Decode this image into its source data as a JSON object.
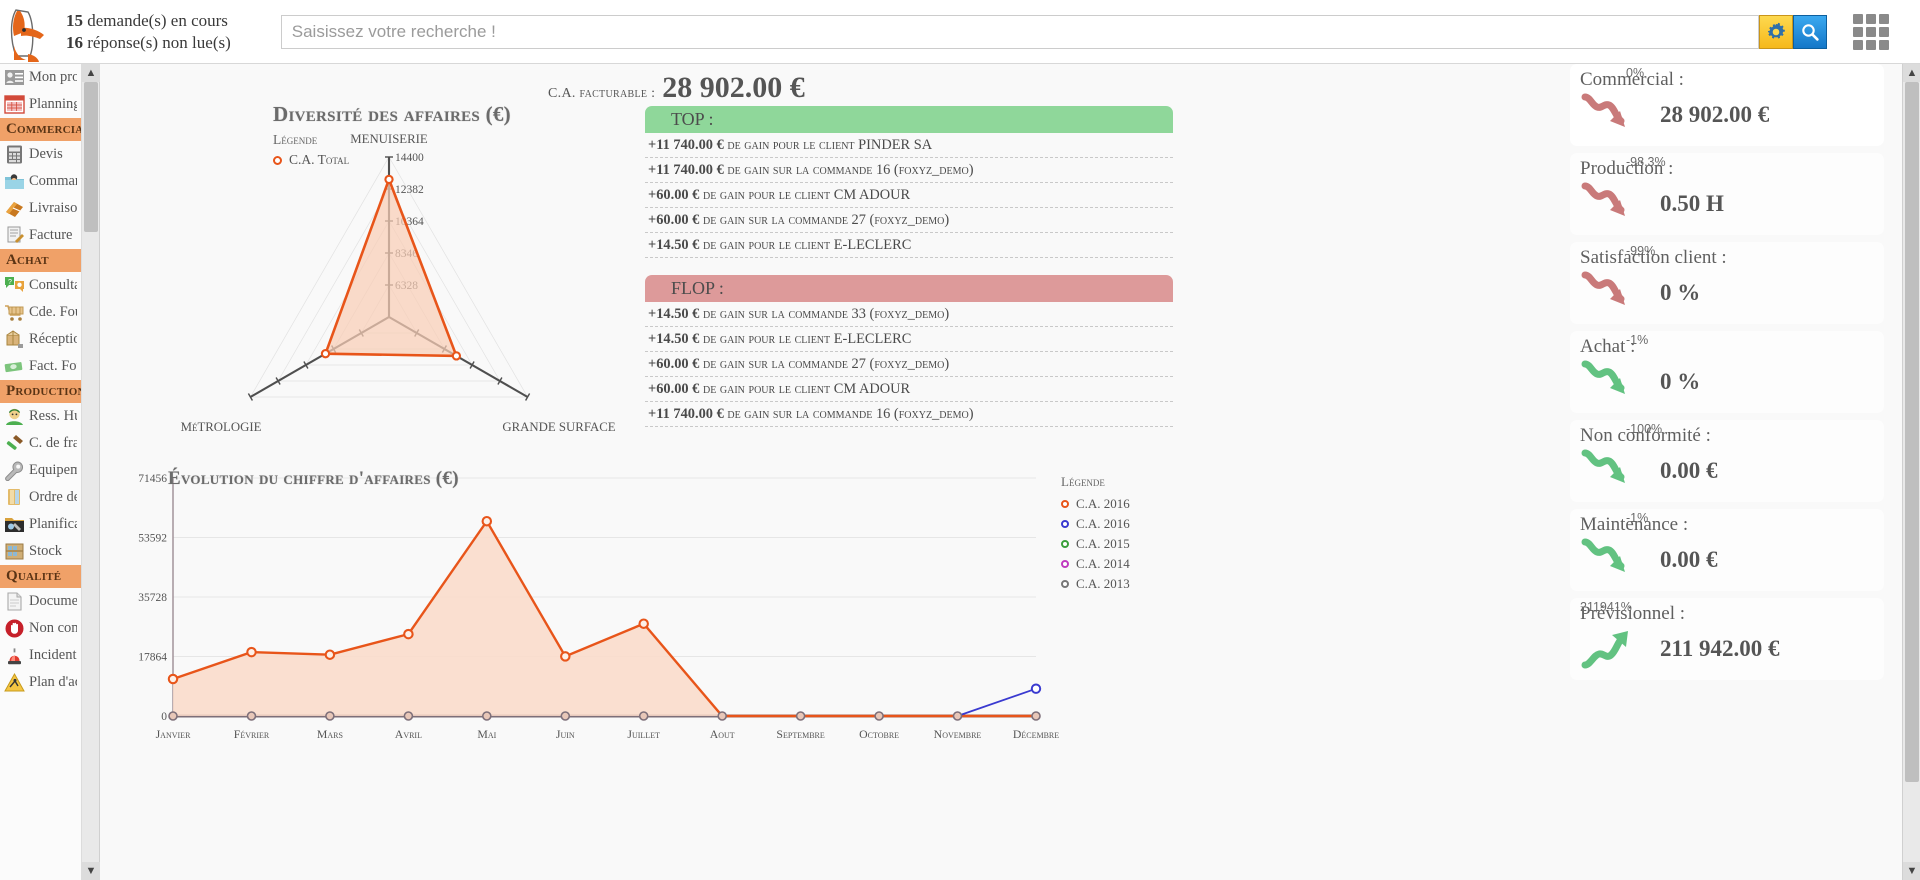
{
  "header": {
    "demandes": "15",
    "demandes_text": "demande(s) en cours",
    "reponses": "16",
    "reponses_text": "réponse(s) non lue(s)",
    "search_placeholder": "Saisissez votre recherche !",
    "search_value": "",
    "gear_icon": "gear-icon",
    "search_icon": "search-icon",
    "apps_icon": "apps-grid-icon",
    "home_icon": "home-icon"
  },
  "sidebar": {
    "items": [
      {
        "type": "item",
        "label": "Mon profil",
        "icon": "profile-icon"
      },
      {
        "type": "item",
        "label": "Planning",
        "icon": "calendar-icon"
      },
      {
        "type": "head",
        "label": "Commercial"
      },
      {
        "type": "item",
        "label": "Devis",
        "icon": "calculator-icon"
      },
      {
        "type": "item",
        "label": "Commande",
        "icon": "order-folder-icon"
      },
      {
        "type": "item",
        "label": "Livraison",
        "icon": "delivery-icon"
      },
      {
        "type": "item",
        "label": "Facture",
        "icon": "invoice-icon"
      },
      {
        "type": "head",
        "label": "Achat"
      },
      {
        "type": "item",
        "label": "Consultation",
        "icon": "consultation-icon"
      },
      {
        "type": "item",
        "label": "Cde. Fourn.",
        "icon": "cart-icon"
      },
      {
        "type": "item",
        "label": "Réception",
        "icon": "package-icon"
      },
      {
        "type": "item",
        "label": "Fact. Fourn.",
        "icon": "money-icon"
      },
      {
        "type": "head",
        "label": "Production"
      },
      {
        "type": "item",
        "label": "Ress. Hum.",
        "icon": "worker-icon"
      },
      {
        "type": "item",
        "label": "C. de frais",
        "icon": "hammer-icon"
      },
      {
        "type": "item",
        "label": "Equipement",
        "icon": "wrench-icon"
      },
      {
        "type": "item",
        "label": "Ordre de fab.",
        "icon": "book-folder-icon"
      },
      {
        "type": "item",
        "label": "Planification",
        "icon": "planning-folder-icon"
      },
      {
        "type": "item",
        "label": "Stock",
        "icon": "shelf-icon"
      },
      {
        "type": "head",
        "label": "Qualité"
      },
      {
        "type": "item",
        "label": "Document",
        "icon": "document-icon"
      },
      {
        "type": "item",
        "label": "Non confor.",
        "icon": "stop-hand-icon"
      },
      {
        "type": "item",
        "label": "Incident",
        "icon": "siren-icon"
      },
      {
        "type": "item",
        "label": "Plan d'actions",
        "icon": "warning-triangle-icon"
      }
    ]
  },
  "main": {
    "ca_label": "C.A. facturable :",
    "ca_value": "28 902.00 €"
  },
  "top_list": {
    "title": "TOP :",
    "color": "#8fd79a",
    "rows": [
      {
        "amount": "+11 740.00 €",
        "mid": "de gain pour le client",
        "tail": "PINDER SA"
      },
      {
        "amount": "+11 740.00 €",
        "mid": "de gain sur la commande",
        "tail": "16 (foxyz_demo)"
      },
      {
        "amount": "+60.00 €",
        "mid": "de gain pour le client",
        "tail": "CM ADOUR"
      },
      {
        "amount": "+60.00 €",
        "mid": "de gain sur la commande",
        "tail": "27 (foxyz_demo)"
      },
      {
        "amount": "+14.50 €",
        "mid": "de gain pour le client",
        "tail": "E-LECLERC"
      }
    ]
  },
  "flop_list": {
    "title": "FLOP :",
    "color": "#dd9a9a",
    "rows": [
      {
        "amount": "+14.50 €",
        "mid": "de gain sur la commande",
        "tail": "33 (foxyz_demo)"
      },
      {
        "amount": "+14.50 €",
        "mid": "de gain pour le client",
        "tail": "E-LECLERC"
      },
      {
        "amount": "+60.00 €",
        "mid": "de gain sur la commande",
        "tail": "27 (foxyz_demo)"
      },
      {
        "amount": "+60.00 €",
        "mid": "de gain pour le client",
        "tail": "CM ADOUR"
      },
      {
        "amount": "+11 740.00 €",
        "mid": "de gain sur la commande",
        "tail": "16 (foxyz_demo)"
      }
    ]
  },
  "kpi": {
    "cards": [
      {
        "title": "Commercial :",
        "pct": "0%",
        "value": "28 902.00 €",
        "dir": "down",
        "color": "#c97a7a"
      },
      {
        "title": "Production :",
        "pct": "-98.3%",
        "value": "0.50 H",
        "dir": "down",
        "color": "#c97a7a"
      },
      {
        "title": "Satisfaction client :",
        "pct": "-99%",
        "value": "0 %",
        "dir": "down",
        "color": "#c97a7a"
      },
      {
        "title": "Achat :",
        "pct": "-1%",
        "value": "0 %",
        "dir": "down",
        "color": "#62c281"
      },
      {
        "title": "Non conformité :",
        "pct": "-100%",
        "value": "0.00 €",
        "dir": "down",
        "color": "#62c281"
      },
      {
        "title": "Maintenance :",
        "pct": "-1%",
        "value": "0.00 €",
        "dir": "down",
        "color": "#62c281"
      },
      {
        "title": "Prévisionnel :",
        "pct": "211941%",
        "value": "211 942.00 €",
        "dir": "up",
        "color": "#62c281"
      }
    ]
  },
  "chart_data": [
    {
      "type": "radar",
      "title": "Diversité des affaires (€)",
      "legend_title": "Légende",
      "legend": [
        {
          "name": "C.A. Total",
          "color": "#e8551a"
        }
      ],
      "categories": [
        "MENUISERIE",
        "GRANDE SURFACE",
        "MéTROLOGIE"
      ],
      "tick_labels": [
        "14400",
        "12382",
        "10364",
        "8346",
        "6328"
      ],
      "axis_max": 14400,
      "values": [
        12382,
        7000,
        6600
      ],
      "fill": "#f8cdb5",
      "stroke": "#e8551a"
    },
    {
      "type": "line",
      "title": "Évolution du chiffre d'affaires (€)",
      "legend_title": "Légende",
      "xlabel": "",
      "ylabel": "",
      "ylim": [
        0,
        71456
      ],
      "yticks": [
        0,
        17864,
        35728,
        53592,
        71456
      ],
      "grid": true,
      "legend_position": "right",
      "categories": [
        "Janvier",
        "Février",
        "Mars",
        "Avril",
        "Mai",
        "Juin",
        "Juillet",
        "Aout",
        "Septembre",
        "Octobre",
        "Novembre",
        "Décembre"
      ],
      "series": [
        {
          "name": "C.A. 2016",
          "color": "#e8551a",
          "filled": true,
          "values": [
            11100,
            19200,
            18400,
            24600,
            58500,
            17900,
            27700,
            0,
            0,
            0,
            0,
            0
          ]
        },
        {
          "name": "C.A. 2016",
          "color": "#3a3ad0",
          "filled": false,
          "values": [
            null,
            null,
            null,
            null,
            null,
            null,
            null,
            null,
            null,
            null,
            0,
            8200
          ]
        },
        {
          "name": "C.A. 2015",
          "color": "#3aa03a",
          "filled": false,
          "values": [
            null,
            null,
            null,
            null,
            null,
            null,
            null,
            null,
            null,
            null,
            null,
            null
          ]
        },
        {
          "name": "C.A. 2014",
          "color": "#c03ac0",
          "filled": false,
          "values": [
            null,
            null,
            null,
            null,
            null,
            null,
            null,
            null,
            null,
            null,
            null,
            null
          ]
        },
        {
          "name": "C.A. 2013",
          "color": "#777777",
          "filled": false,
          "values": [
            null,
            null,
            null,
            null,
            null,
            null,
            null,
            null,
            null,
            null,
            null,
            null
          ]
        }
      ]
    }
  ]
}
